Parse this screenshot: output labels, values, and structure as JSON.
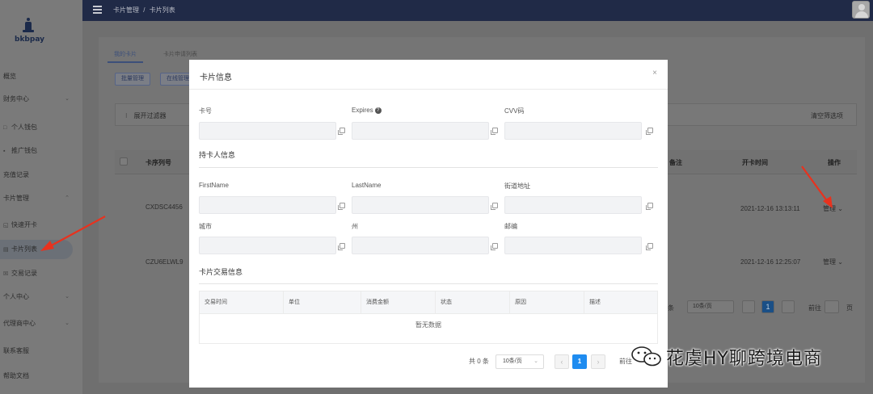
{
  "brand": {
    "name": "bkbpay"
  },
  "topbar": {
    "breadcrumb_1": "卡片管理",
    "breadcrumb_sep": "/",
    "breadcrumb_2": "卡片列表"
  },
  "sidebar": {
    "items": [
      {
        "label": "概览"
      },
      {
        "label": "财务中心",
        "chevron": "⌄"
      },
      {
        "label": "个人钱包",
        "icon": "□"
      },
      {
        "label": "推广钱包",
        "icon": "▪"
      },
      {
        "label": "充值记录"
      },
      {
        "label": "卡片管理",
        "chevron": "⌃"
      },
      {
        "label": "快速开卡",
        "icon": "◱"
      },
      {
        "label": "卡片列表",
        "icon": "▤"
      },
      {
        "label": "交易记录",
        "icon": "☒"
      },
      {
        "label": "个人中心",
        "chevron": "⌄"
      },
      {
        "label": "代理商中心",
        "chevron": "⌄"
      },
      {
        "label": "联系客服"
      },
      {
        "label": "帮助文档"
      }
    ]
  },
  "background": {
    "tabs": [
      "我的卡片",
      "卡片申请列表"
    ],
    "buttons": [
      "批量管理",
      "在线管理"
    ],
    "filter_label": "展开过滤器",
    "filter_icon": "⁝",
    "clear_filters": "清空筛选项",
    "columns": {
      "card_no": "卡序列号",
      "remark": "备注",
      "open_time": "开卡时间",
      "actions": "操作"
    },
    "rows": [
      {
        "card_no": "CXDSC4456",
        "open_time": "2021-12-16 13:13:11",
        "action": "管理"
      },
      {
        "card_no": "CZU6ELWL9",
        "open_time": "2021-12-16 12:25:07",
        "action": "管理"
      }
    ],
    "pager": {
      "total_tail": "条",
      "per_page": "10条/页",
      "page": "1",
      "goto": "前往",
      "page_unit": "页"
    }
  },
  "modal": {
    "title": "卡片信息",
    "close": "×",
    "fields": {
      "card_number": "卡号",
      "expires": "Expires",
      "cvv": "CVV码"
    },
    "holder_section": "持卡人信息",
    "holder_fields": {
      "first_name": "FirstName",
      "last_name": "LastName",
      "street": "街道地址",
      "city": "城市",
      "state": "州",
      "zip": "邮编"
    },
    "tx_section": "卡片交易信息",
    "tx_columns": [
      "交易时间",
      "单位",
      "消费金额",
      "状态",
      "原因",
      "描述"
    ],
    "tx_empty": "暂无数据",
    "pager": {
      "total": "共 0 条",
      "per_page": "10条/页",
      "page": "1",
      "goto": "前往"
    }
  },
  "watermark": {
    "text": "花虞HY聊跨境电商"
  },
  "colors": {
    "accent": "#1f8cf0",
    "topbar": "#202a47",
    "annotation": "#e8321e"
  }
}
